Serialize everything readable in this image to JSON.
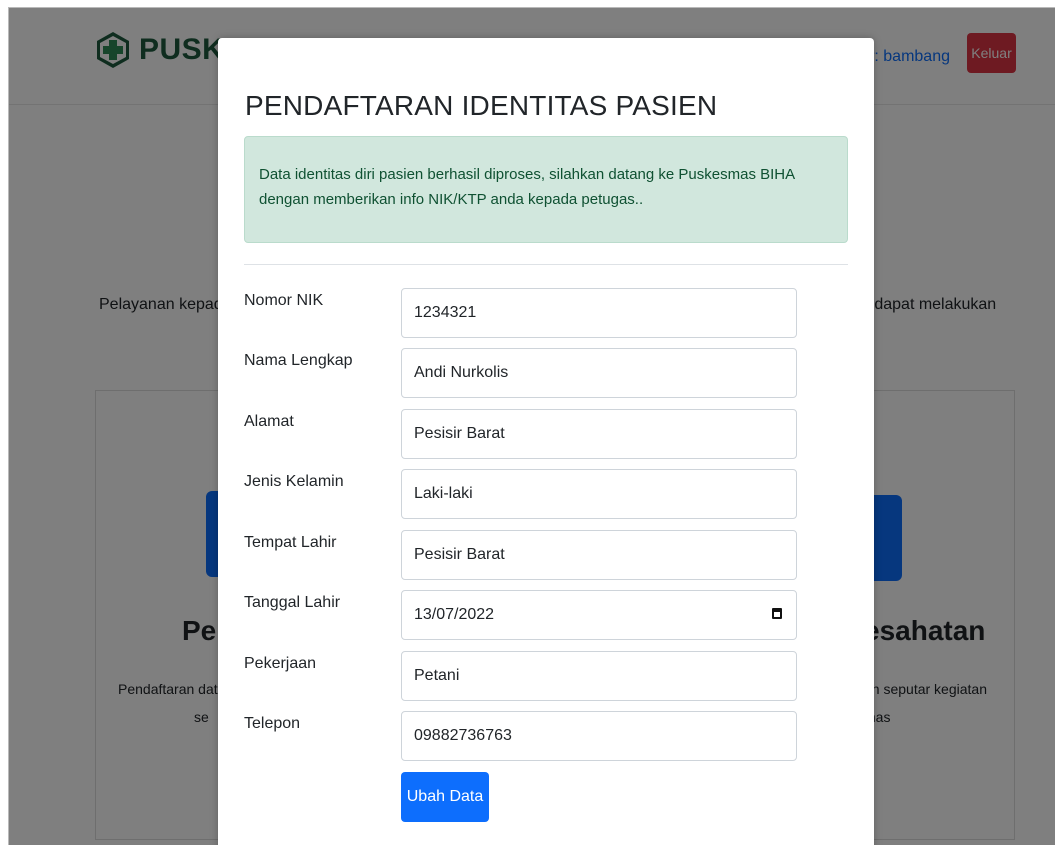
{
  "navbar": {
    "brand_text": "PUSKESMAS BIHA",
    "user_text": "r: bambang",
    "logout_label": "Keluar"
  },
  "background": {
    "intro_left": "Pelayanan kepad",
    "intro_right": "a dapat melakukan",
    "service_left_title": "Pen",
    "service_left_desc_1": "Pendaftaran data",
    "service_left_desc_2": "se",
    "service_right_title": "esahatan",
    "service_right_desc_1": "an seputar kegiatan",
    "service_right_desc_2": "mas"
  },
  "modal": {
    "title": "PENDAFTARAN IDENTITAS PASIEN",
    "alert_text": "Data identitas diri pasien berhasil diproses, silahkan datang ke Puskesmas BIHA dengan memberikan info NIK/KTP anda kepada petugas..",
    "fields": [
      {
        "label": "Nomor NIK",
        "value": "1234321"
      },
      {
        "label": "Nama Lengkap",
        "value": "Andi Nurkolis"
      },
      {
        "label": "Alamat",
        "value": "Pesisir Barat"
      },
      {
        "label": "Jenis Kelamin",
        "value": "Laki-laki"
      },
      {
        "label": "Tempat Lahir",
        "value": "Pesisir Barat"
      },
      {
        "label": "Tanggal Lahir",
        "value": "13/07/2022"
      },
      {
        "label": "Pekerjaan",
        "value": "Petani"
      },
      {
        "label": "Telepon",
        "value": "09882736763"
      }
    ],
    "submit_label": "Ubah Data"
  },
  "colors": {
    "primary": "#0d6efd",
    "danger": "#dc3545",
    "success_bg": "#d1e7dd",
    "success_text": "#0f5132",
    "brand": "#1e5a3f"
  },
  "icons": {
    "brand_logo": "medical-cross-hexagon-icon",
    "date_picker": "calendar-icon"
  }
}
